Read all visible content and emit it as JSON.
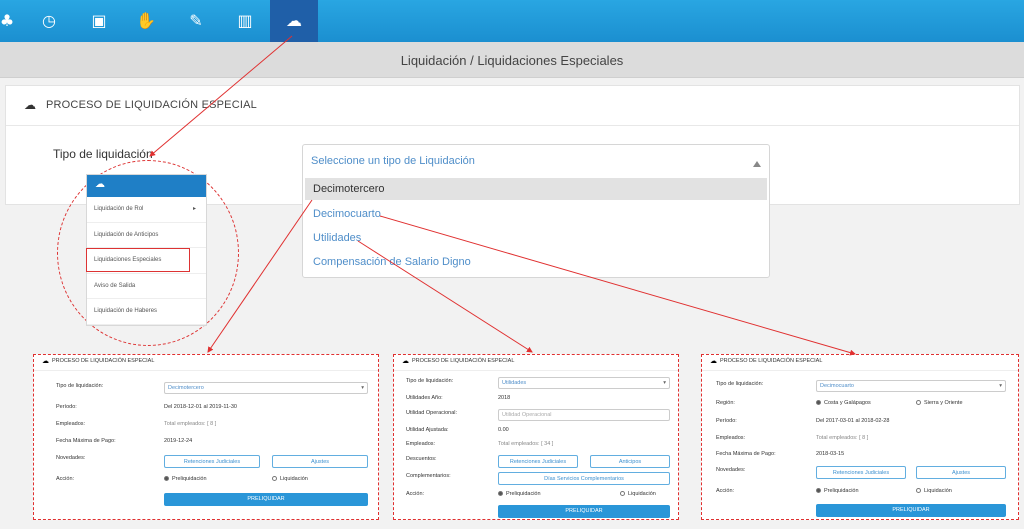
{
  "title": "Liquidación / Liquidaciones Especiales",
  "panel_title": "PROCESO DE LIQUIDACIÓN ESPECIAL",
  "tipo_label": "Tipo de liquidación",
  "dropdown": {
    "placeholder": "Seleccione un tipo de Liquidación",
    "options": [
      "Decimotercero",
      "Decimocuarto",
      "Utilidades",
      "Compensación de Salario Digno"
    ]
  },
  "menu": {
    "items": [
      "Liquidación de Rol",
      "Liquidación de Anticipos",
      "Liquidaciones Especiales",
      "Aviso de Salida",
      "Liquidación de Haberes"
    ]
  },
  "colors": {
    "brand": "#1f7fc6",
    "accent": "#2a96d8",
    "annotation": "#e03030"
  },
  "panel1": {
    "title": "PROCESO DE LIQUIDACIÓN ESPECIAL",
    "tipo_label": "Tipo de liquidación:",
    "tipo_value": "Decimotercero",
    "periodo_label": "Período:",
    "periodo_value": "Del 2018-12-01 al 2019-11-30",
    "empleados_label": "Empleados:",
    "empleados_value": "Total empleados: [ 8 ]",
    "fecha_label": "Fecha Máxima de Pago:",
    "fecha_value": "2019-12-24",
    "novedades_label": "Novedades:",
    "btn_retenciones": "Retenciones Judiciales",
    "btn_ajustes": "Ajustes",
    "accion_label": "Acción:",
    "radio_preliq": "Preliquidación",
    "radio_liq": "Liquidación",
    "btn_preliquidar": "PRELIQUIDAR"
  },
  "panel2": {
    "title": "PROCESO DE LIQUIDACIÓN ESPECIAL",
    "tipo_label": "Tipo de liquidación:",
    "tipo_value": "Utilidades",
    "utilidades_anio_label": "Utilidades Año:",
    "utilidades_anio_value": "2018",
    "utilidad_op_label": "Utilidad Operacional:",
    "utilidad_op_placeholder": "Utilidad Operacional",
    "utilidad_aj_label": "Utilidad Ajustada:",
    "utilidad_aj_value": "0.00",
    "empleados_label": "Empleados:",
    "empleados_value": "Total empleados: [ 34 ]",
    "descuentos_label": "Descuentos:",
    "btn_retenciones": "Retenciones Judiciales",
    "btn_anticipos": "Anticipos",
    "complementarios_label": "Complementarios:",
    "btn_dias": "Días Servicios Complementarios",
    "accion_label": "Acción:",
    "radio_preliq": "Preliquidación",
    "radio_liq": "Liquidación",
    "btn_preliquidar": "PRELIQUIDAR"
  },
  "panel3": {
    "title": "PROCESO DE LIQUIDACIÓN ESPECIAL",
    "tipo_label": "Tipo de liquidación:",
    "tipo_value": "Decimocuarto",
    "region_label": "Región:",
    "region_costa": "Costa y Galápagos",
    "region_sierra": "Sierra y Oriente",
    "periodo_label": "Período:",
    "periodo_value": "Del 2017-03-01 al 2018-02-28",
    "empleados_label": "Empleados:",
    "empleados_value": "Total empleados: [ 8 ]",
    "fecha_label": "Fecha Máxima de Pago:",
    "fecha_value": "2018-03-15",
    "novedades_label": "Novedades:",
    "btn_retenciones": "Retenciones Judiciales",
    "btn_ajustes": "Ajustes",
    "accion_label": "Acción:",
    "radio_preliq": "Preliquidación",
    "radio_liq": "Liquidación",
    "btn_preliquidar": "PRELIQUIDAR"
  }
}
